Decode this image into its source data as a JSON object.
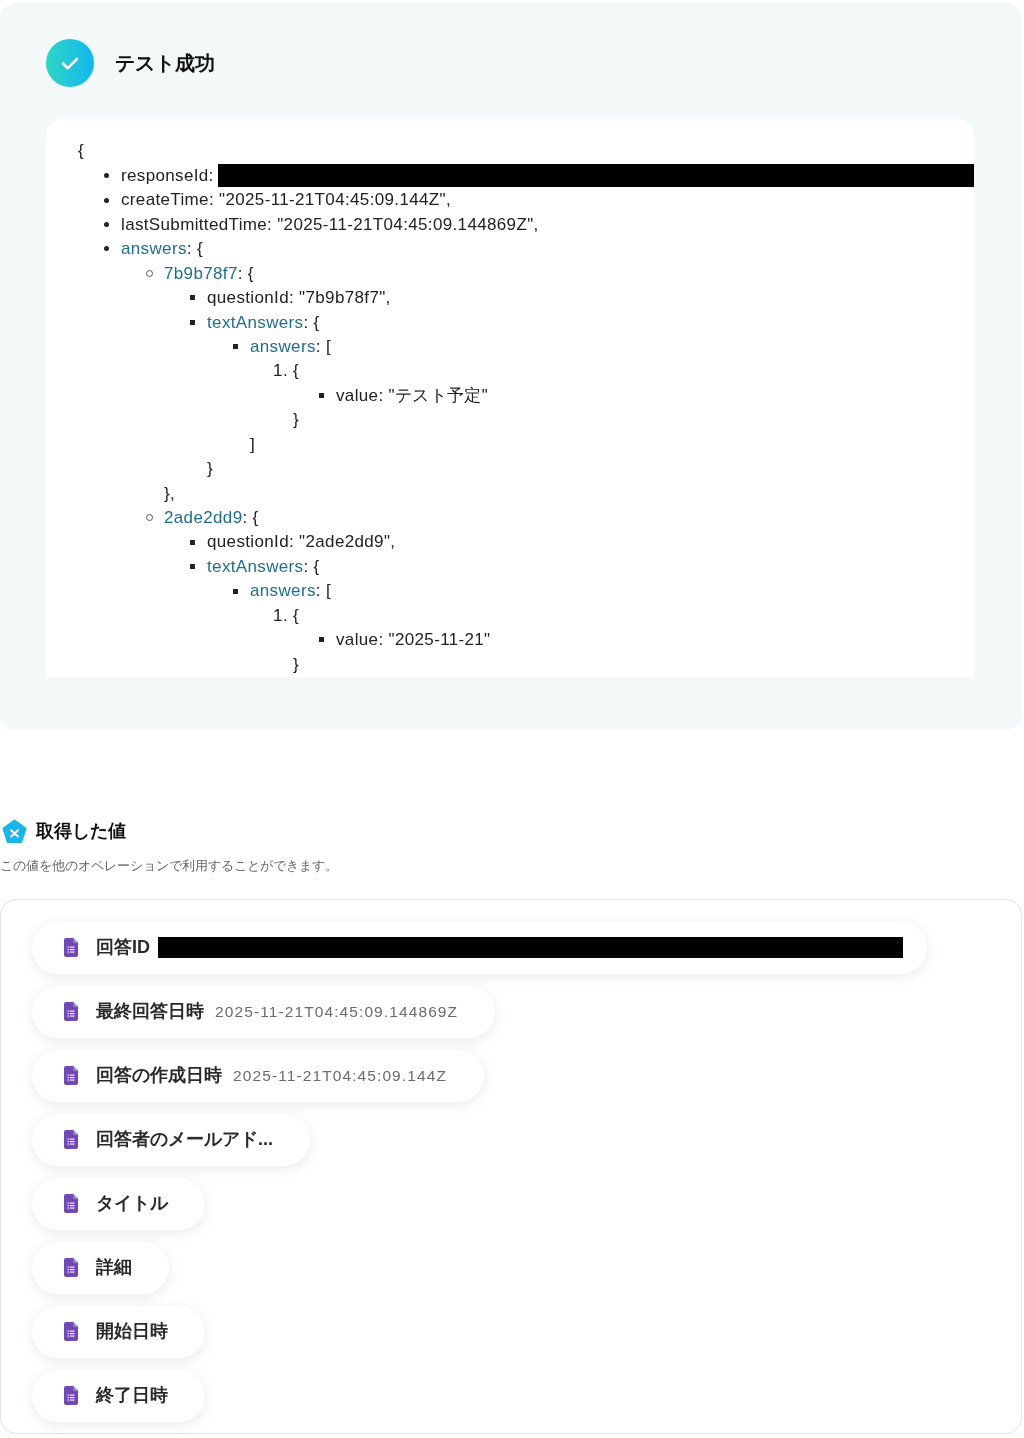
{
  "panel": {
    "title": "テスト成功"
  },
  "code": {
    "open": "{",
    "items": [
      {
        "kind": "field",
        "text": "responseId:",
        "redacted": true
      },
      {
        "kind": "field",
        "text": "createTime: \"2025-11-21T04:45:09.144Z\",",
        "redacted": false
      },
      {
        "kind": "field",
        "text": "lastSubmittedTime: \"2025-11-21T04:45:09.144869Z\",",
        "redacted": false
      },
      {
        "kind": "object",
        "key": "answers",
        "text": ": {",
        "redacted": false,
        "children": [
          {
            "kind": "object",
            "key": "7b9b78f7",
            "text": ": {",
            "children": [
              {
                "kind": "field",
                "text": "questionId: \"7b9b78f7\","
              },
              {
                "kind": "object",
                "key": "textAnswers",
                "text": ": {",
                "children": [
                  {
                    "kind": "object",
                    "key": "answers",
                    "text": ": [",
                    "children": [
                      {
                        "kind": "entry",
                        "marker": "1.",
                        "text": "{",
                        "children": [
                          {
                            "kind": "field",
                            "text": "value: \"テスト予定\""
                          }
                        ],
                        "close": "}"
                      }
                    ],
                    "close": "]"
                  }
                ],
                "close": "}"
              }
            ],
            "close": "},"
          },
          {
            "kind": "object",
            "key": "2ade2dd9",
            "text": ": {",
            "children": [
              {
                "kind": "field",
                "text": "questionId: \"2ade2dd9\","
              },
              {
                "kind": "object",
                "key": "textAnswers",
                "text": ": {",
                "children": [
                  {
                    "kind": "object",
                    "key": "answers",
                    "text": ": [",
                    "children": [
                      {
                        "kind": "entry",
                        "marker": "1.",
                        "text": "{",
                        "children": [
                          {
                            "kind": "field",
                            "text": "value: \"2025-11-21\""
                          }
                        ],
                        "close": "}"
                      }
                    ]
                  }
                ]
              }
            ]
          }
        ]
      }
    ]
  },
  "outputs": {
    "title": "取得した値",
    "description": "この値を他のオペレーションで利用することができます。",
    "items": [
      {
        "label": "回答ID",
        "redacted": true
      },
      {
        "label": "最終回答日時",
        "value": "2025-11-21T04:45:09.144869Z",
        "redacted": false
      },
      {
        "label": "回答の作成日時",
        "value": "2025-11-21T04:45:09.144Z",
        "redacted": false
      },
      {
        "label": "回答者のメールアド...",
        "redacted": false
      },
      {
        "label": "タイトル",
        "redacted": false
      },
      {
        "label": "詳細",
        "redacted": false
      },
      {
        "label": "開始日時",
        "redacted": false
      },
      {
        "label": "終了日時",
        "redacted": false
      }
    ]
  }
}
